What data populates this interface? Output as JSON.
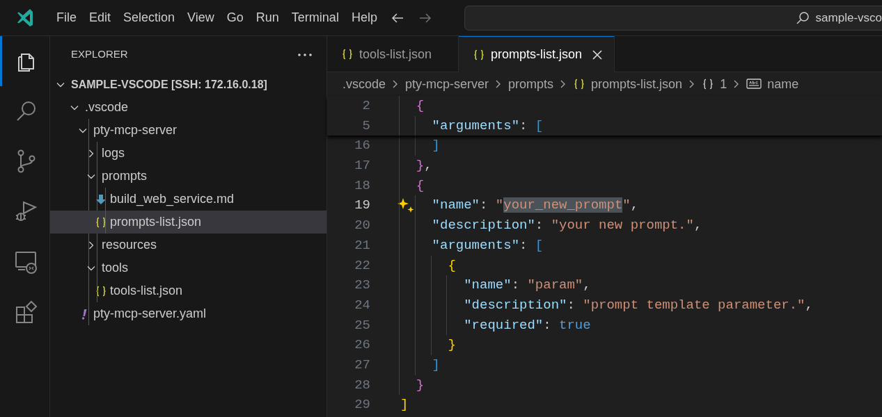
{
  "title_bar": {
    "menu": [
      "File",
      "Edit",
      "Selection",
      "View",
      "Go",
      "Run",
      "Terminal",
      "Help"
    ],
    "nav": [
      {
        "kind": "back",
        "disabled": false
      },
      {
        "kind": "forward",
        "disabled": true
      }
    ],
    "search": {
      "value": "sample-vsco"
    }
  },
  "activity_bar": [
    {
      "kind": "explorer",
      "selected": true
    },
    {
      "kind": "search",
      "selected": false
    },
    {
      "kind": "source-control",
      "selected": false
    },
    {
      "kind": "run-debug",
      "selected": false
    },
    {
      "kind": "remote",
      "selected": false
    },
    {
      "kind": "extensions",
      "selected": false
    }
  ],
  "sidebar": {
    "title": "EXPLORER",
    "root": {
      "label": "SAMPLE-VSCODE [SSH: 172.16.0.18]",
      "expanded": true
    },
    "tree": [
      {
        "label": ".vscode",
        "kind": "folder",
        "expanded": true,
        "selected": false,
        "children": [
          {
            "label": "pty-mcp-server",
            "kind": "folder",
            "expanded": true,
            "selected": false,
            "children": [
              {
                "label": "logs",
                "kind": "folder",
                "expanded": false,
                "selected": false
              },
              {
                "label": "prompts",
                "kind": "folder",
                "expanded": true,
                "selected": false,
                "children": [
                  {
                    "label": "build_web_service.md",
                    "kind": "markdown",
                    "selected": false
                  },
                  {
                    "label": "prompts-list.json",
                    "kind": "json",
                    "selected": true
                  }
                ]
              },
              {
                "label": "resources",
                "kind": "folder",
                "expanded": false,
                "selected": false
              },
              {
                "label": "tools",
                "kind": "folder",
                "expanded": true,
                "selected": false,
                "children": [
                  {
                    "label": "tools-list.json",
                    "kind": "json",
                    "selected": false
                  }
                ]
              }
            ]
          },
          {
            "label": "pty-mcp-server.yaml",
            "kind": "yaml",
            "selected": false
          }
        ]
      }
    ]
  },
  "tabs": [
    {
      "label": "tools-list.json",
      "kind": "json",
      "selected": false
    },
    {
      "label": "prompts-list.json",
      "kind": "json",
      "selected": true
    }
  ],
  "breadcrumb": [
    {
      "label": ".vscode",
      "kind": "folder"
    },
    {
      "label": "pty-mcp-server",
      "kind": "folder"
    },
    {
      "label": "prompts",
      "kind": "folder"
    },
    {
      "label": "prompts-list.json",
      "kind": "json"
    },
    {
      "label": "1",
      "kind": "object"
    },
    {
      "label": "name",
      "kind": "string"
    }
  ],
  "editor": {
    "sticky_lines": [
      {
        "number": "2",
        "current": false,
        "tokens": [
          {
            "kind": "bracket",
            "color": "#da70d6",
            "text": "  {"
          }
        ]
      },
      {
        "number": "5",
        "current": false,
        "tokens": [
          {
            "kind": "key",
            "text": "    \"arguments\""
          },
          {
            "kind": "punct",
            "text": ": "
          },
          {
            "kind": "bracket",
            "color": "#179fff",
            "text": "["
          }
        ]
      }
    ],
    "lines": [
      {
        "number": "16",
        "current": false,
        "tokens": [
          {
            "kind": "bracket",
            "color": "#179fff",
            "text": "    ]"
          }
        ]
      },
      {
        "number": "17",
        "current": false,
        "tokens": [
          {
            "kind": "bracket",
            "color": "#da70d6",
            "text": "  }"
          },
          {
            "kind": "punct",
            "text": ","
          }
        ]
      },
      {
        "number": "18",
        "current": false,
        "tokens": [
          {
            "kind": "bracket",
            "color": "#da70d6",
            "text": "  {"
          }
        ]
      },
      {
        "number": "19",
        "current": true,
        "tokens": [
          {
            "kind": "key",
            "text": "    \"name\""
          },
          {
            "kind": "punct",
            "text": ": "
          },
          {
            "kind": "string",
            "text": "\""
          },
          {
            "kind": "selection",
            "text": "your_new_prompt"
          },
          {
            "kind": "string",
            "text": "\""
          },
          {
            "kind": "punct",
            "text": ","
          }
        ]
      },
      {
        "number": "20",
        "current": false,
        "tokens": [
          {
            "kind": "key",
            "text": "    \"description\""
          },
          {
            "kind": "punct",
            "text": ": "
          },
          {
            "kind": "string",
            "text": "\"your new prompt.\""
          },
          {
            "kind": "punct",
            "text": ","
          }
        ]
      },
      {
        "number": "21",
        "current": false,
        "tokens": [
          {
            "kind": "key",
            "text": "    \"arguments\""
          },
          {
            "kind": "punct",
            "text": ": "
          },
          {
            "kind": "bracket",
            "color": "#179fff",
            "text": "["
          }
        ]
      },
      {
        "number": "22",
        "current": false,
        "tokens": [
          {
            "kind": "bracket",
            "color": "#ffd700",
            "text": "      {"
          }
        ]
      },
      {
        "number": "23",
        "current": false,
        "tokens": [
          {
            "kind": "key",
            "text": "        \"name\""
          },
          {
            "kind": "punct",
            "text": ": "
          },
          {
            "kind": "string",
            "text": "\"param\""
          },
          {
            "kind": "punct",
            "text": ","
          }
        ]
      },
      {
        "number": "24",
        "current": false,
        "tokens": [
          {
            "kind": "key",
            "text": "        \"description\""
          },
          {
            "kind": "punct",
            "text": ": "
          },
          {
            "kind": "string",
            "text": "\"prompt template parameter.\""
          },
          {
            "kind": "punct",
            "text": ","
          }
        ]
      },
      {
        "number": "25",
        "current": false,
        "tokens": [
          {
            "kind": "key",
            "text": "        \"required\""
          },
          {
            "kind": "punct",
            "text": ": "
          },
          {
            "kind": "keyword",
            "text": "true"
          }
        ]
      },
      {
        "number": "26",
        "current": false,
        "tokens": [
          {
            "kind": "bracket",
            "color": "#ffd700",
            "text": "      }"
          }
        ]
      },
      {
        "number": "27",
        "current": false,
        "tokens": [
          {
            "kind": "bracket",
            "color": "#179fff",
            "text": "    ]"
          }
        ]
      },
      {
        "number": "28",
        "current": false,
        "tokens": [
          {
            "kind": "bracket",
            "color": "#da70d6",
            "text": "  }"
          }
        ]
      },
      {
        "number": "29",
        "current": false,
        "tokens": [
          {
            "kind": "bracket",
            "color": "#ffd700",
            "text": "]"
          }
        ]
      }
    ]
  }
}
